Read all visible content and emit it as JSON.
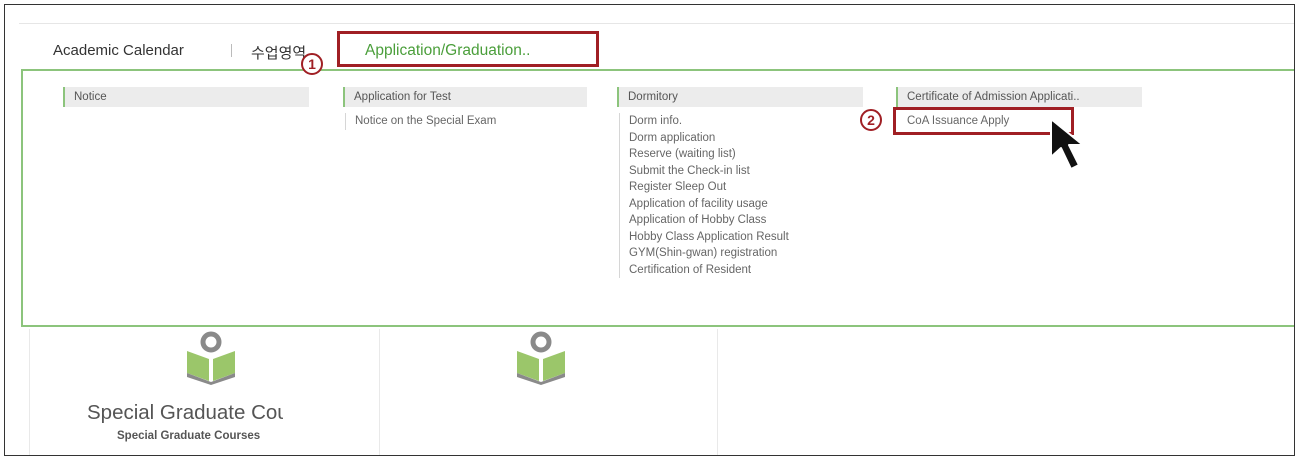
{
  "nav": {
    "items": [
      {
        "label": "Academic Calendar"
      },
      {
        "label": "수업영역"
      },
      {
        "label": "Application/Graduation.."
      }
    ]
  },
  "annotations": {
    "step1": "1",
    "step2": "2"
  },
  "menu": {
    "notice": {
      "header": "Notice",
      "items": []
    },
    "test": {
      "header": "Application for Test",
      "items": [
        "Notice on the Special Exam"
      ]
    },
    "dorm": {
      "header": "Dormitory",
      "items": [
        "Dorm info.",
        "Dorm application",
        "Reserve (waiting list)",
        "Submit the Check-in list",
        "Register Sleep Out",
        "Application of facility usage",
        "Application of Hobby Class",
        "Hobby Class Application Result",
        "GYM(Shin-gwan) registration",
        "Certification of Resident"
      ]
    },
    "coa": {
      "header": "Certificate of Admission Applicati..",
      "items": [
        "CoA Issuance Apply"
      ]
    }
  },
  "cards": [
    {
      "title": "Special Graduate Course",
      "subtitle": "Special Graduate Courses",
      "icon": "book-pin-icon"
    },
    {
      "title": "",
      "subtitle": "",
      "icon": "book-pin-icon"
    }
  ],
  "colors": {
    "accent_green": "#4a9e3a",
    "menu_border": "#8cc47c",
    "annotation_red": "#a01f24",
    "icon_green": "#9bc66a",
    "icon_gray": "#8a8a8a"
  }
}
